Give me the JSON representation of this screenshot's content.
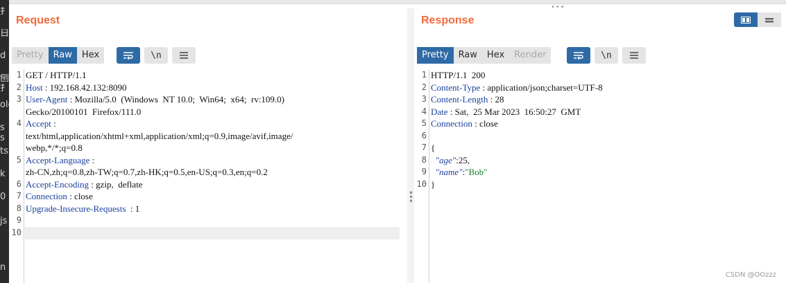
{
  "left_strip_fragments": [
    "扌",
    "日",
    "d",
    "刨",
    "扌",
    "old",
    "s",
    "s",
    "ts",
    "k",
    "0",
    "js",
    "",
    "n"
  ],
  "top_drag_handle": "•••",
  "request": {
    "title": "Request",
    "tabs": [
      {
        "label": "Pretty",
        "state": "disabled"
      },
      {
        "label": "Raw",
        "state": "active"
      },
      {
        "label": "Hex",
        "state": "normal"
      }
    ],
    "newline_label": "\\n",
    "lines": [
      {
        "n": "1",
        "parts": [
          {
            "t": "GET / HTTP/1.1",
            "c": "plain"
          }
        ]
      },
      {
        "n": "2",
        "parts": [
          {
            "t": "Host",
            "c": "key"
          },
          {
            "t": " : 192.168.42.132:8090",
            "c": "plain"
          }
        ]
      },
      {
        "n": "3",
        "parts": [
          {
            "t": "User-Agent",
            "c": "key"
          },
          {
            "t": " : Mozilla/5.0  (Windows  NT 10.0;  Win64;  x64;  rv:109.0)",
            "c": "plain"
          }
        ]
      },
      {
        "n": "",
        "parts": [
          {
            "t": "Gecko/20100101  Firefox/111.0",
            "c": "plain"
          }
        ]
      },
      {
        "n": "4",
        "parts": [
          {
            "t": "Accept",
            "c": "key"
          },
          {
            "t": " :",
            "c": "plain"
          }
        ]
      },
      {
        "n": "",
        "parts": [
          {
            "t": "text/html,application/xhtml+xml,application/xml;q=0.9,image/avif,image/",
            "c": "plain"
          }
        ]
      },
      {
        "n": "",
        "parts": [
          {
            "t": "webp,*/*;q=0.8",
            "c": "plain"
          }
        ]
      },
      {
        "n": "5",
        "parts": [
          {
            "t": "Accept-Language",
            "c": "key"
          },
          {
            "t": " :",
            "c": "plain"
          }
        ]
      },
      {
        "n": "",
        "parts": [
          {
            "t": "zh-CN,zh;q=0.8,zh-TW;q=0.7,zh-HK;q=0.5,en-US;q=0.3,en;q=0.2",
            "c": "plain"
          }
        ]
      },
      {
        "n": "6",
        "parts": [
          {
            "t": "Accept-Encoding",
            "c": "key"
          },
          {
            "t": " : gzip,  deflate",
            "c": "plain"
          }
        ]
      },
      {
        "n": "7",
        "parts": [
          {
            "t": "Connection",
            "c": "key"
          },
          {
            "t": " : close",
            "c": "plain"
          }
        ]
      },
      {
        "n": "8",
        "parts": [
          {
            "t": "Upgrade-Insecure-Requests",
            "c": "key"
          },
          {
            "t": "  : 1",
            "c": "plain"
          }
        ]
      },
      {
        "n": "9",
        "parts": []
      },
      {
        "n": "10",
        "parts": []
      }
    ]
  },
  "response": {
    "title": "Response",
    "tabs": [
      {
        "label": "Pretty",
        "state": "active"
      },
      {
        "label": "Raw",
        "state": "normal"
      },
      {
        "label": "Hex",
        "state": "normal"
      },
      {
        "label": "Render",
        "state": "disabled"
      }
    ],
    "newline_label": "\\n",
    "lines": [
      {
        "n": "1",
        "parts": [
          {
            "t": "HTTP/1.1  200",
            "c": "plain"
          }
        ]
      },
      {
        "n": "2",
        "parts": [
          {
            "t": "Content-Type",
            "c": "key"
          },
          {
            "t": " : application/json;charset=UTF-8",
            "c": "plain"
          }
        ]
      },
      {
        "n": "3",
        "parts": [
          {
            "t": "Content-Length",
            "c": "key"
          },
          {
            "t": " : 28",
            "c": "plain"
          }
        ]
      },
      {
        "n": "4",
        "parts": [
          {
            "t": "Date",
            "c": "key"
          },
          {
            "t": " : Sat,  25 Mar 2023  16:50:27  GMT",
            "c": "plain"
          }
        ]
      },
      {
        "n": "5",
        "parts": [
          {
            "t": "Connection",
            "c": "key"
          },
          {
            "t": " : close",
            "c": "plain"
          }
        ]
      },
      {
        "n": "6",
        "parts": []
      },
      {
        "n": "7",
        "parts": [
          {
            "t": "{",
            "c": "plain"
          }
        ]
      },
      {
        "n": "8",
        "parts": [
          {
            "t": "  \"age\"",
            "c": "jkey"
          },
          {
            "t": ":25,",
            "c": "plain"
          }
        ]
      },
      {
        "n": "9",
        "parts": [
          {
            "t": "  \"name\"",
            "c": "jkey"
          },
          {
            "t": ":",
            "c": "plain"
          },
          {
            "t": "\"Bob\"",
            "c": "str"
          }
        ]
      },
      {
        "n": "10",
        "parts": [
          {
            "t": "}",
            "c": "plain"
          }
        ]
      }
    ]
  },
  "watermark": "CSDN @OOzzz",
  "colors": {
    "accent": "#f26b3a",
    "active_tab": "#2e6aa5",
    "header_key": "#1a3f9c",
    "json_string": "#1a7a2a"
  }
}
